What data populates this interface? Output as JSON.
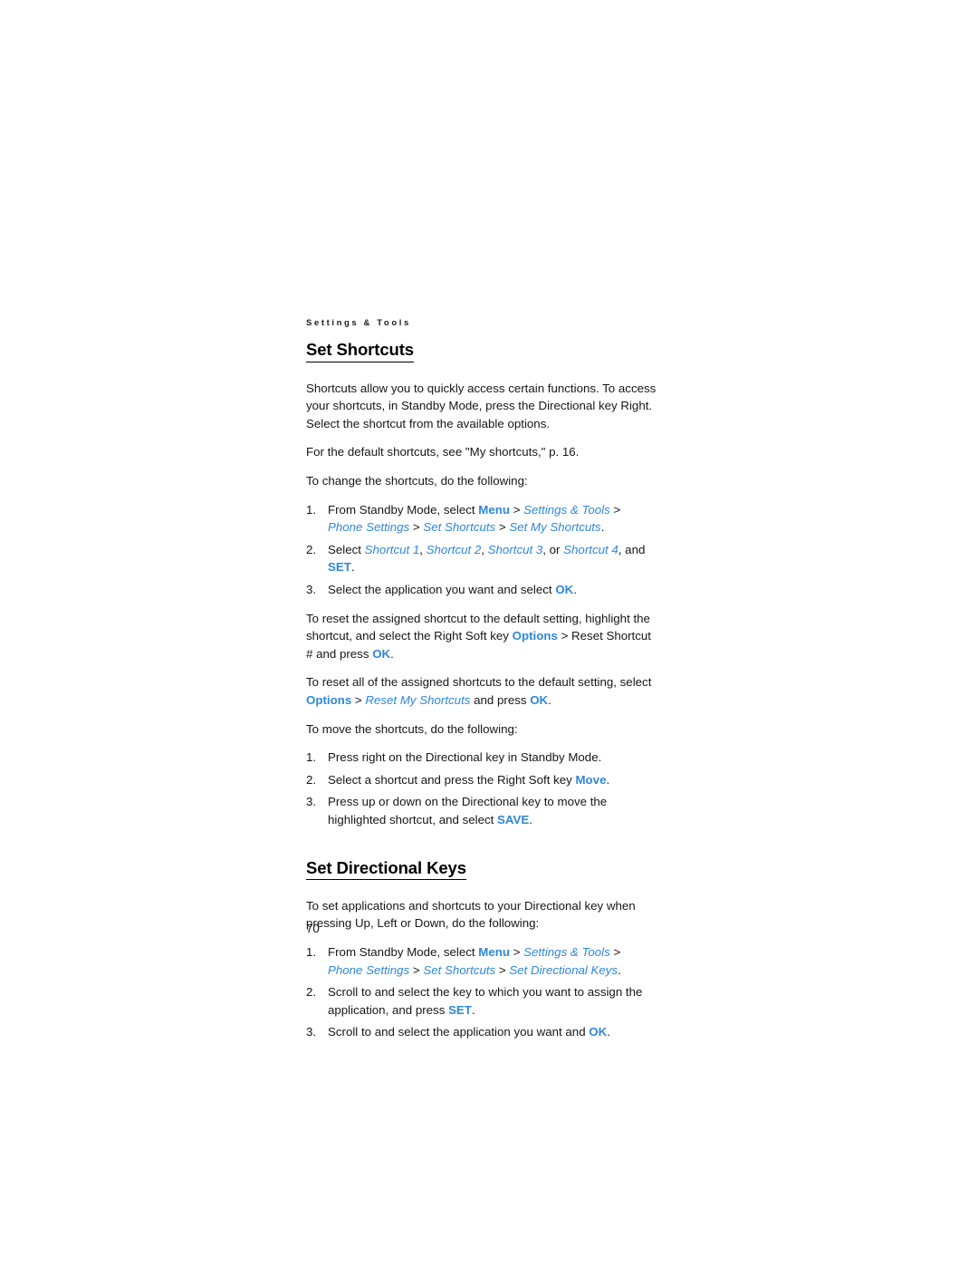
{
  "document": {
    "running_header": "Settings & Tools",
    "page_number": "70"
  },
  "sections": [
    {
      "heading": "Set Shortcuts",
      "intro_paragraph": "Shortcuts allow you to quickly access certain functions. To access your shortcuts, in Standby Mode, press the Directional key Right. Select the shortcut from the available options.",
      "default_shortcuts_note": "For the default shortcuts, see \"My shortcuts,\" p. 16.",
      "change_lead_in": "To change the shortcuts, do the following:",
      "change_steps": {
        "step1": {
          "prefix": "From Standby Mode, select ",
          "key_menu": "Menu",
          "sep1": " > ",
          "nav1": "Settings & Tools",
          "sep2": " > ",
          "nav2": "Phone Settings",
          "sep3": " > ",
          "nav3": "Set Shortcuts",
          "sep4": " > ",
          "nav4": "Set My Shortcuts",
          "suffix": "."
        },
        "step2": {
          "prefix": "Select ",
          "nav1": "Shortcut 1",
          "sep1": ", ",
          "nav2": "Shortcut 2",
          "sep2": ", ",
          "nav3": "Shortcut 3",
          "sep3": ", or ",
          "nav4": "Shortcut 4",
          "sep4": ", and ",
          "key_set": "SET",
          "suffix": "."
        },
        "step3": {
          "prefix": "Select the application you want and select ",
          "key_ok": "OK",
          "suffix": "."
        }
      },
      "reset_one_paragraph": {
        "prefix": "To reset the assigned shortcut to the default setting, highlight the shortcut, and select the Right Soft key ",
        "key_options": "Options",
        "middle": " > Reset Shortcut # and press ",
        "key_ok": "OK",
        "suffix": "."
      },
      "reset_all_paragraph": {
        "prefix": "To reset all of the assigned shortcuts to the default setting, select ",
        "key_options": "Options",
        "sep1": " > ",
        "nav_reset": "Reset My Shortcuts",
        "middle": " and press ",
        "key_ok": "OK",
        "suffix": "."
      },
      "move_lead_in": "To move the shortcuts, do the following:",
      "move_steps": {
        "step1": {
          "text": "Press right on the Directional key in Standby Mode."
        },
        "step2": {
          "prefix": "Select a shortcut and press the Right Soft key ",
          "key_move": "Move",
          "suffix": "."
        },
        "step3": {
          "prefix": "Press up or down on the Directional key to move the highlighted shortcut, and select ",
          "key_save": "SAVE",
          "suffix": "."
        }
      }
    },
    {
      "heading": "Set Directional Keys",
      "intro_paragraph": "To set applications and shortcuts to your Directional key when pressing Up, Left or Down, do the following:",
      "steps": {
        "step1": {
          "prefix": "From Standby Mode, select ",
          "key_menu": "Menu",
          "sep1": " > ",
          "nav1": "Settings & Tools",
          "sep2": " > ",
          "nav2": "Phone Settings",
          "sep3": " > ",
          "nav3": "Set Shortcuts",
          "sep4": " > ",
          "nav4": "Set Directional Keys",
          "suffix": "."
        },
        "step2": {
          "prefix": "Scroll to and select the key to which you want to assign the application, and press ",
          "key_set": "SET",
          "suffix": "."
        },
        "step3": {
          "prefix": "Scroll to and select the application you want and ",
          "key_ok": "OK",
          "suffix": "."
        }
      }
    }
  ],
  "colors": {
    "accent_blue": "#2e87de",
    "body_text": "#161616",
    "heading_text": "#000000",
    "page_background": "#ffffff"
  }
}
